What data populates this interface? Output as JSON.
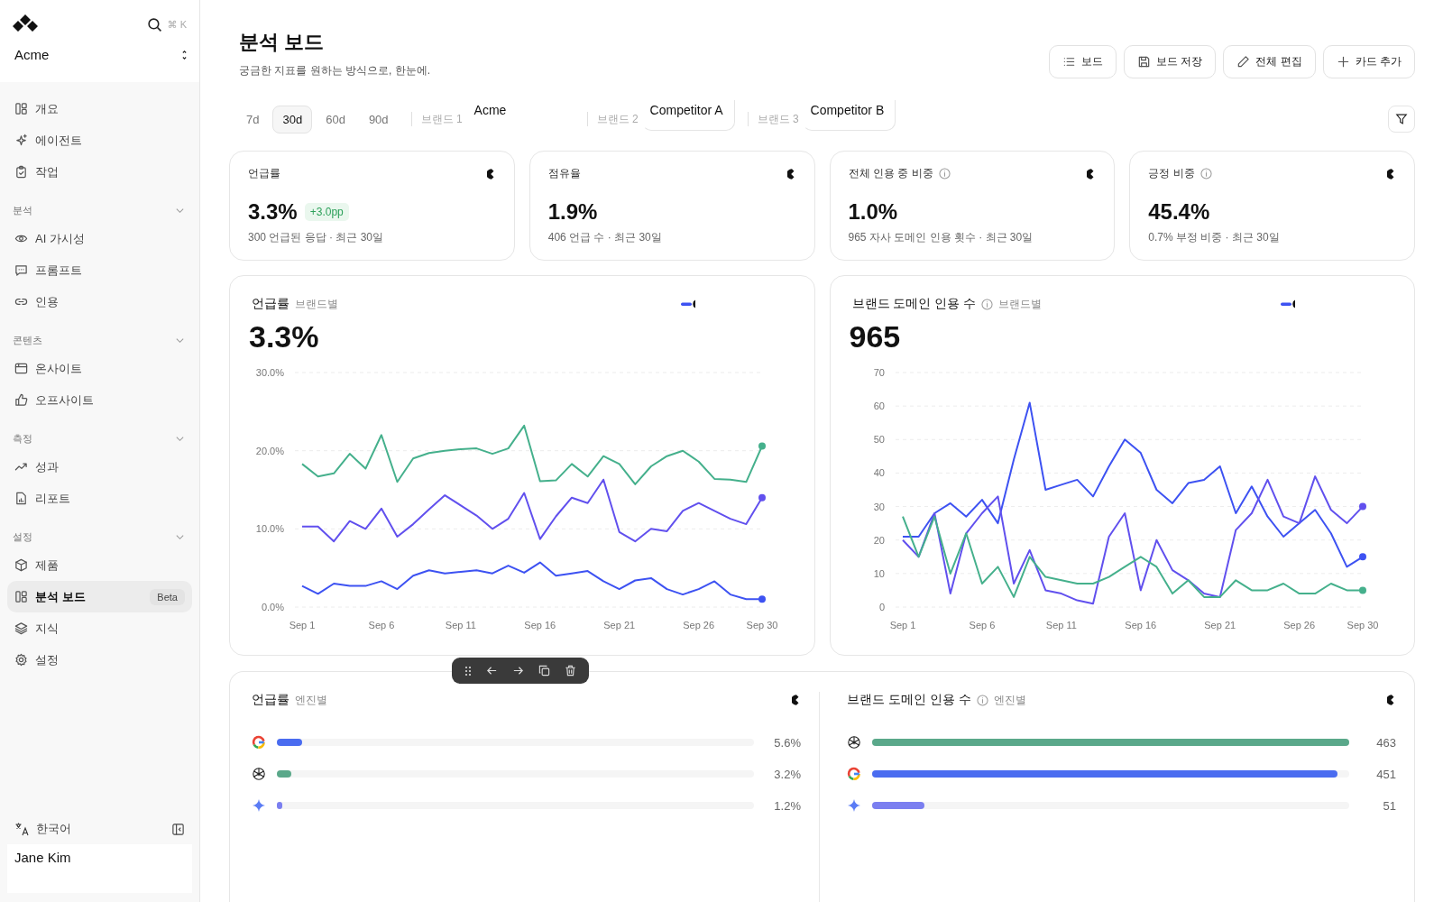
{
  "sidebar": {
    "workspace": "Acme",
    "search_shortcut": "⌘ K",
    "sections": [
      {
        "items": [
          {
            "label": "개요",
            "selected": false
          },
          {
            "label": "에이전트",
            "selected": false
          },
          {
            "label": "작업",
            "selected": false
          }
        ]
      },
      {
        "title": "분석",
        "expanded": true,
        "items": [
          {
            "label": "AI 가시성",
            "selected": false
          },
          {
            "label": "프롬프트",
            "selected": false
          },
          {
            "label": "인용",
            "selected": false
          }
        ]
      },
      {
        "title": "콘텐츠",
        "expanded": true,
        "items": [
          {
            "label": "온사이트",
            "selected": false
          },
          {
            "label": "오프사이트",
            "selected": false
          }
        ]
      },
      {
        "title": "측정",
        "expanded": true,
        "items": [
          {
            "label": "성과",
            "selected": false
          },
          {
            "label": "리포트",
            "selected": false
          }
        ]
      },
      {
        "title": "설정",
        "expanded": true,
        "items": [
          {
            "label": "제품",
            "selected": false
          },
          {
            "label": "분석 보드",
            "selected": true,
            "badge": "Beta"
          },
          {
            "label": "지식",
            "selected": false
          },
          {
            "label": "설정",
            "selected": false
          }
        ]
      }
    ],
    "language": "한국어",
    "user": "Jane Kim"
  },
  "page": {
    "title": "분석 보드",
    "subtitle": "궁금한 지표를 원하는 방식으로, 한눈에."
  },
  "toolbar": [
    "보드",
    "보드 저장",
    "전체 편집",
    "카드 추가"
  ],
  "periods": [
    {
      "label": "7d",
      "selected": false
    },
    {
      "label": "30d",
      "selected": true
    },
    {
      "label": "60d",
      "selected": false
    },
    {
      "label": "90d",
      "selected": false
    }
  ],
  "brands": [
    {
      "label": "브랜드 1",
      "value": "Acme"
    },
    {
      "label": "브랜드 2",
      "value": "Competitor A"
    },
    {
      "label": "브랜드 3",
      "value": "Competitor B"
    }
  ],
  "kpis": [
    {
      "title": "언급률",
      "info": false,
      "value": "3.3%",
      "delta": "+3.0pp",
      "caption": "300 언급된 응답 · 최근 30일"
    },
    {
      "title": "점유율",
      "info": false,
      "value": "1.9%",
      "caption": "406 언급 수 · 최근 30일"
    },
    {
      "title": "전체 인용 중 비중",
      "info": true,
      "value": "1.0%",
      "caption": "965 자사 도메인 인용 횟수 · 최근 30일"
    },
    {
      "title": "긍정 비중",
      "info": true,
      "value": "45.4%",
      "caption": "0.7% 부정 비중 · 최근 30일"
    }
  ],
  "charts": [
    {
      "title": "언급률",
      "subtitle": "브랜드별",
      "info": false,
      "value": "3.3%",
      "chart_data": {
        "type": "line",
        "categories": [
          "Sep 1",
          null,
          null,
          null,
          null,
          "Sep 6",
          null,
          null,
          null,
          null,
          "Sep 11",
          null,
          null,
          null,
          null,
          "Sep 16",
          null,
          null,
          null,
          null,
          "Sep 21",
          null,
          null,
          null,
          null,
          "Sep 26",
          null,
          null,
          null,
          "Sep 30"
        ],
        "grid": true,
        "ylim": [
          0,
          30
        ],
        "yticks": [
          {
            "value": 0,
            "label": "0.0%"
          },
          {
            "value": 10,
            "label": "10.0%"
          },
          {
            "value": 20,
            "label": "20.0%"
          },
          {
            "value": 30,
            "label": "30.0%"
          }
        ],
        "series": [
          {
            "color": "#45b08c",
            "values": [
              18.3,
              16.7,
              17.1,
              19.6,
              17.7,
              22,
              16,
              19,
              19.7,
              20,
              20.2,
              20.3,
              19.6,
              20.3,
              23.2,
              16.1,
              16.2,
              18.3,
              16.7,
              19.3,
              18.3,
              15.7,
              18,
              19.3,
              20,
              18.6,
              16.4,
              16.3,
              16,
              20.6
            ]
          },
          {
            "color": "#6150ee",
            "values": [
              10.3,
              10.3,
              8.4,
              11,
              10,
              12.6,
              9,
              10.6,
              12.5,
              14.3,
              13,
              11.7,
              10,
              11.3,
              14.6,
              8.7,
              11.6,
              14,
              13.3,
              16.3,
              9.6,
              8.4,
              10,
              9.7,
              12.3,
              13.3,
              12.3,
              11.3,
              10.6,
              14
            ]
          },
          {
            "color": "#3d52f2",
            "values": [
              2.7,
              1.7,
              3,
              2.7,
              2.7,
              3.3,
              2.3,
              4,
              4.7,
              4.3,
              4.5,
              4.7,
              4.3,
              5.3,
              4.4,
              5.7,
              4,
              4.3,
              4.6,
              3.3,
              2.3,
              3.4,
              3.7,
              2.3,
              1.6,
              2.3,
              3.3,
              1.6,
              1,
              1
            ]
          }
        ]
      }
    },
    {
      "title": "브랜드 도메인 인용 수",
      "subtitle": "브랜드별",
      "info": true,
      "value": "965",
      "chart_data": {
        "type": "line",
        "categories": [
          "Sep 1",
          null,
          null,
          null,
          null,
          "Sep 6",
          null,
          null,
          null,
          null,
          "Sep 11",
          null,
          null,
          null,
          null,
          "Sep 16",
          null,
          null,
          null,
          null,
          "Sep 21",
          null,
          null,
          null,
          null,
          "Sep 26",
          null,
          null,
          null,
          "Sep 30"
        ],
        "grid": true,
        "ylim": [
          0,
          70
        ],
        "yticks": [
          0,
          10,
          20,
          30,
          40,
          50,
          60,
          70
        ],
        "series": [
          {
            "color": "#3d52f2",
            "values": [
              21,
              21,
              28,
              31,
              27,
              32,
              25,
              44,
              61,
              35,
              36.5,
              38,
              33,
              42,
              50,
              46,
              35,
              31,
              37,
              38,
              42,
              28,
              36,
              27,
              21,
              25,
              29,
              22,
              12,
              15
            ]
          },
          {
            "color": "#6150ee",
            "values": [
              20,
              15,
              28,
              4,
              22,
              28,
              33,
              7,
              17,
              5,
              4,
              2,
              1,
              21,
              28,
              5,
              20,
              11,
              8,
              4,
              3,
              23,
              28,
              38,
              27,
              25,
              39,
              29,
              25,
              30
            ]
          },
          {
            "color": "#45b08c",
            "values": [
              27,
              15,
              27,
              10,
              22,
              7,
              12,
              3,
              15,
              9,
              8,
              7,
              7,
              9,
              12,
              15,
              12,
              4,
              8,
              3,
              3,
              8,
              5,
              5,
              7,
              4,
              4,
              7,
              5,
              5
            ]
          }
        ]
      }
    }
  ],
  "engine_cards": [
    {
      "title": "언급률",
      "subtitle": "엔진별",
      "info": false,
      "rows": [
        {
          "kind": "google",
          "reading": "5.6%",
          "level": 0.053,
          "color": "#4a6cf0"
        },
        {
          "kind": "chatgpt",
          "reading": "3.2%",
          "level": 0.03,
          "color": "#5aa88a"
        },
        {
          "kind": "gemini",
          "reading": "1.2%",
          "level": 0.01,
          "color": "#7b7ff0"
        }
      ]
    },
    {
      "title": "브랜드 도메인 인용 수",
      "subtitle": "엔진별",
      "info": true,
      "rows": [
        {
          "kind": "chatgpt",
          "reading": "463",
          "level": 1.0,
          "color": "#5aa88a"
        },
        {
          "kind": "google",
          "reading": "451",
          "level": 0.975,
          "color": "#4a6cf0"
        },
        {
          "kind": "gemini",
          "reading": "51",
          "level": 0.11,
          "color": "#7b7ff0"
        }
      ]
    }
  ]
}
